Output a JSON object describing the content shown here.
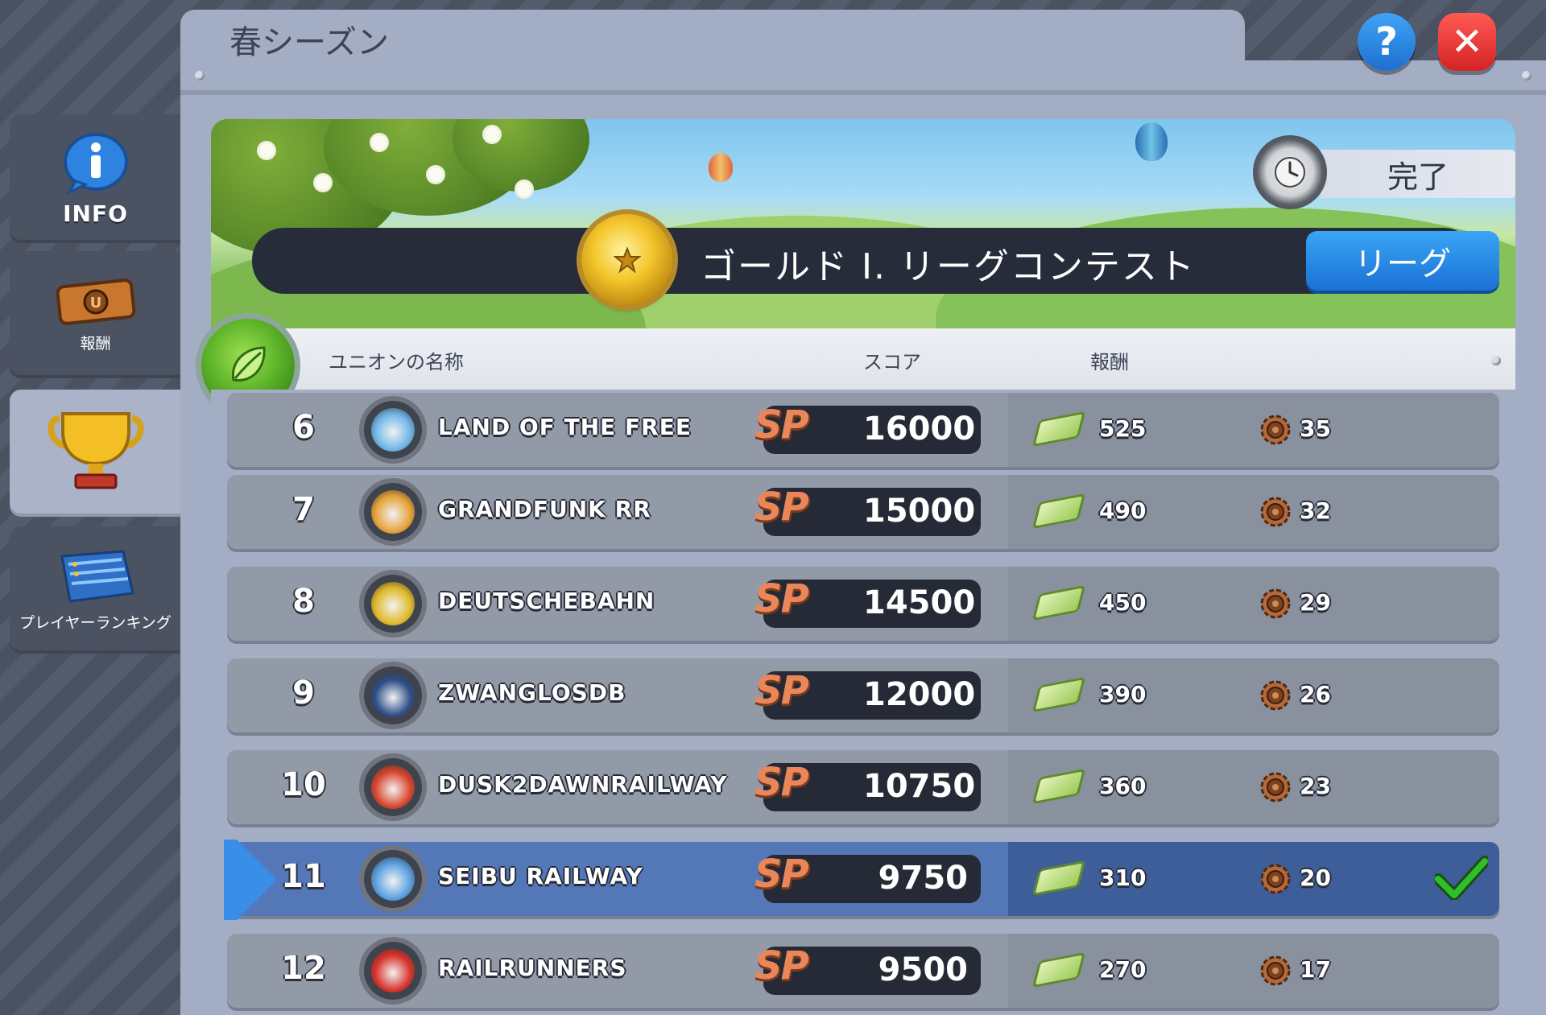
{
  "window": {
    "title": "春シーズン"
  },
  "sidebar": {
    "items": [
      {
        "label": "INFO",
        "icon": "info-icon",
        "active": false
      },
      {
        "label": "報酬",
        "icon": "ticket-icon",
        "active": false
      },
      {
        "label": "",
        "icon": "trophy-icon",
        "active": true
      },
      {
        "label": "プレイヤーランキング",
        "icon": "ranking-board-icon",
        "active": false
      }
    ]
  },
  "top_buttons": {
    "help": "?",
    "close": "✕"
  },
  "banner": {
    "status": "完了",
    "league_name": "ゴールド I. リーグコンテスト",
    "league_button": "リーグ"
  },
  "table": {
    "columns": {
      "name": "ユニオンの名称",
      "score": "スコア",
      "reward": "報酬"
    },
    "score_badge": "SP",
    "rows": [
      {
        "rank": "6",
        "name": "LAND OF THE FREE",
        "score": "16000",
        "cash": "525",
        "gears": "35",
        "icon_color": "#6fb6e6",
        "highlight": false
      },
      {
        "rank": "7",
        "name": "GRANDFUNK RR",
        "score": "15000",
        "cash": "490",
        "gears": "32",
        "icon_color": "#e6a23a",
        "highlight": false
      },
      {
        "rank": "8",
        "name": "DEUTSCHEBAHN",
        "score": "14500",
        "cash": "450",
        "gears": "29",
        "icon_color": "#e0b92a",
        "highlight": false
      },
      {
        "rank": "9",
        "name": "ZWANGLOSDB",
        "score": "12000",
        "cash": "390",
        "gears": "26",
        "icon_color": "#2f4f88",
        "highlight": false
      },
      {
        "rank": "10",
        "name": "DUSK2DAWNRAILWAY",
        "score": "10750",
        "cash": "360",
        "gears": "23",
        "icon_color": "#d8452e",
        "highlight": false
      },
      {
        "rank": "11",
        "name": "SEIBU RAILWAY",
        "score": "9750",
        "cash": "310",
        "gears": "20",
        "icon_color": "#5aa0e0",
        "highlight": true
      },
      {
        "rank": "12",
        "name": "RAILRUNNERS",
        "score": "9500",
        "cash": "270",
        "gears": "17",
        "icon_color": "#d8322a",
        "highlight": false
      }
    ]
  },
  "colors": {
    "accent_blue": "#1d6fd1",
    "close_red": "#d42323",
    "highlight_row": "#5477b8",
    "sp_orange": "#e9865a",
    "check_green": "#2fbf2a"
  }
}
